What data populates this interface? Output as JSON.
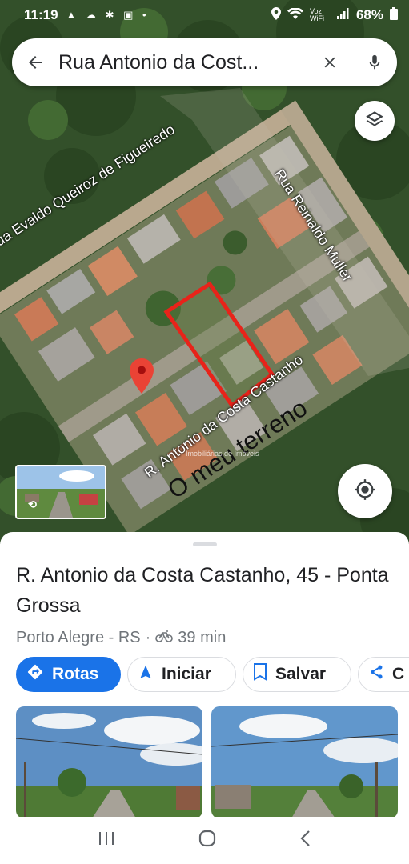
{
  "status_bar": {
    "time": "11:19",
    "network_label": "Voz WiFi",
    "battery": "68%"
  },
  "search": {
    "query": "Rua Antonio da Cost..."
  },
  "map": {
    "street_labels": {
      "evaldo": "ua Evaldo Queiroz de Figueiredo",
      "reinaldo": "Rua Reinaldo Muller",
      "antonio": "R. Antonio da Costa Castanho"
    },
    "annotation": "O meu terreno",
    "watermark": "Imobiliárias de Imóveis"
  },
  "place": {
    "title": "R. Antonio da Costa Castanho, 45 - Ponta Grossa",
    "location": "Porto Alegre - RS",
    "separator": "·",
    "travel_time": "39 min"
  },
  "actions": {
    "directions": "Rotas",
    "start": "Iniciar",
    "save": "Salvar",
    "share": "C"
  },
  "colors": {
    "accent": "#1a73e8",
    "pin": "#ea4335",
    "annotation_box": "#e8231a"
  }
}
